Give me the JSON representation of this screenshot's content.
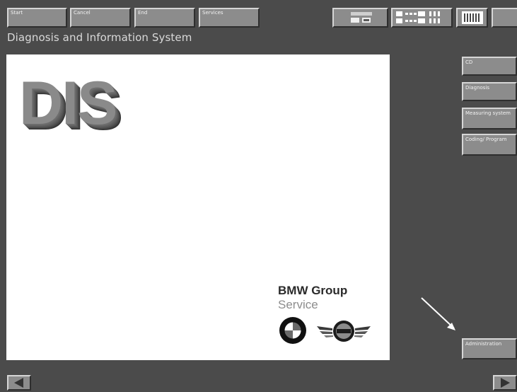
{
  "header": {
    "buttons": [
      {
        "label": "Start",
        "icon": ""
      },
      {
        "label": "Cancel",
        "icon": ""
      },
      {
        "label": "End",
        "icon": ""
      },
      {
        "label": "Services",
        "icon": ""
      }
    ],
    "icon_buttons": [
      "module-icon",
      "connection-status-icon",
      "keyboard-icon",
      "help-icon"
    ],
    "title": "Diagnosis and Information System"
  },
  "main": {
    "logo_text": "DIS",
    "brand_line1": "BMW Group",
    "brand_line2": "Service"
  },
  "sidebar": {
    "items": [
      {
        "label": "CD"
      },
      {
        "label": "Diagnosis"
      },
      {
        "label": "Measuring system"
      },
      {
        "label": "Coding/ Program"
      }
    ],
    "bottom_item": {
      "label": "Administration"
    }
  },
  "navigation": {
    "back_icon": "triangle-left-icon",
    "forward_icon": "triangle-right-icon"
  },
  "colors": {
    "background": "#4b4b4b",
    "button_face": "#8c8c8c",
    "panel": "#ffffff",
    "title_text": "#d9d9d9",
    "brand_text": "#2a2a2a",
    "brand_secondary": "#8d8d8d"
  }
}
